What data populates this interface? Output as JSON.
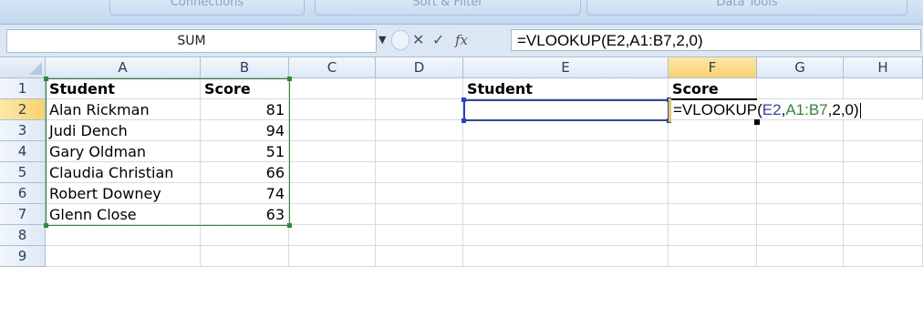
{
  "ribbon": {
    "groups": [
      "Connections",
      "Sort & Filter",
      "Data Tools"
    ]
  },
  "formula_bar": {
    "name_box": "SUM",
    "dropdown_icon": "dropdown-arrow-icon",
    "cancel_icon": "x-cancel-icon",
    "enter_icon": "checkmark-icon",
    "fx_label": "fx",
    "formula": "=VLOOKUP(E2,A1:B7,2,0)"
  },
  "columns": [
    "A",
    "B",
    "C",
    "D",
    "E",
    "F",
    "G",
    "H"
  ],
  "rows": [
    "1",
    "2",
    "3",
    "4",
    "5",
    "6",
    "7",
    "8",
    "9"
  ],
  "cells": {
    "A1": "Student",
    "B1": "Score",
    "A2": "Alan Rickman",
    "B2": "81",
    "A3": "Judi Dench",
    "B3": "94",
    "A4": "Gary Oldman",
    "B4": "51",
    "A5": "Claudia Christian",
    "B5": "66",
    "A6": "Robert Downey",
    "B6": "74",
    "A7": "Glenn Close",
    "B7": "63",
    "E1": "Student",
    "F1": "Score",
    "F2_parts": {
      "prefix": "=VLOOKUP(",
      "ref1": "E2",
      "comma1": ",",
      "ref2": "A1:B7",
      "suffix": ",2,0)"
    }
  },
  "colors": {
    "ref_blue": "#2b3fd1",
    "ref_green": "#2e8b32",
    "active_header": "#f9d26d"
  }
}
